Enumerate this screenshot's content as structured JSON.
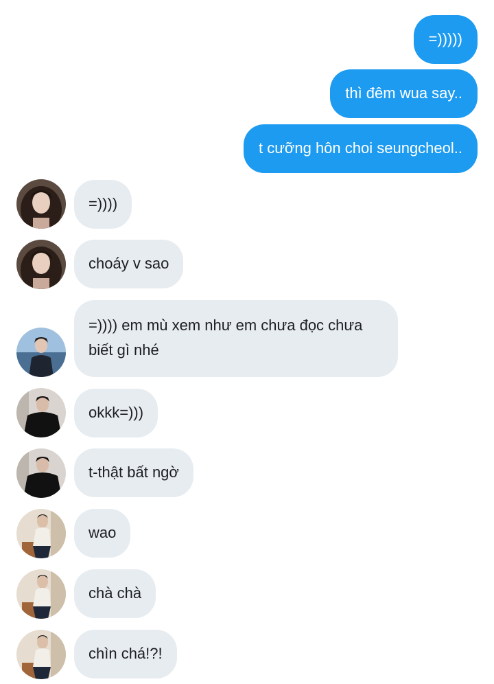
{
  "messages": [
    {
      "direction": "outgoing",
      "text": "=)))))"
    },
    {
      "direction": "outgoing",
      "text": "thì đêm wua say.."
    },
    {
      "direction": "outgoing",
      "text": "t cưỡng hôn choi seungcheol.."
    },
    {
      "direction": "incoming",
      "avatar": "long-hair-woman-avatar",
      "text": "=))))"
    },
    {
      "direction": "incoming",
      "avatar": "long-hair-woman-avatar",
      "text": "choáy v sao"
    },
    {
      "direction": "incoming",
      "avatar": "man-by-water-avatar",
      "text": "=)))) em mù xem như em chưa đọc chưa biết gì nhé"
    },
    {
      "direction": "incoming",
      "avatar": "man-black-outfit-avatar",
      "text": "okkk=)))"
    },
    {
      "direction": "incoming",
      "avatar": "man-black-outfit-avatar",
      "text": "t-thật bất ngờ"
    },
    {
      "direction": "incoming",
      "avatar": "man-seated-light-avatar",
      "text": "wao"
    },
    {
      "direction": "incoming",
      "avatar": "man-seated-light-avatar",
      "text": "chà chà"
    },
    {
      "direction": "incoming",
      "avatar": "man-seated-light-avatar",
      "text": "chìn chá!?!"
    }
  ],
  "colors": {
    "outgoing_bubble": "#1d9bf0",
    "incoming_bubble": "#e7ecf1",
    "outgoing_text": "#ffffff",
    "incoming_text": "#1c1e21"
  }
}
